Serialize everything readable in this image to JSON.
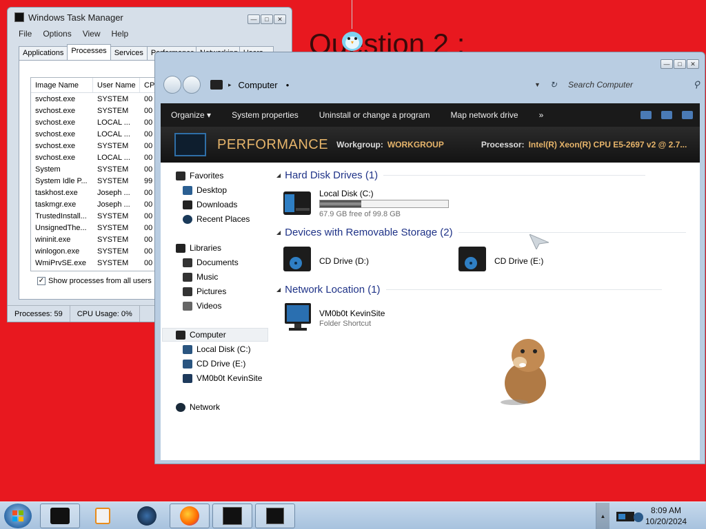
{
  "desktop": {
    "bg_text": "Question 2 :"
  },
  "task_manager": {
    "title": "Windows Task Manager",
    "menu": [
      "File",
      "Options",
      "View",
      "Help"
    ],
    "tabs": [
      "Applications",
      "Processes",
      "Services",
      "Performance",
      "Networking",
      "Users"
    ],
    "active_tab": "Processes",
    "columns": [
      "Image Name",
      "User Name",
      "CPU"
    ],
    "rows": [
      [
        "svchost.exe",
        "SYSTEM",
        "00"
      ],
      [
        "svchost.exe",
        "SYSTEM",
        "00"
      ],
      [
        "svchost.exe",
        "LOCAL ...",
        "00"
      ],
      [
        "svchost.exe",
        "LOCAL ...",
        "00"
      ],
      [
        "svchost.exe",
        "SYSTEM",
        "00"
      ],
      [
        "svchost.exe",
        "LOCAL ...",
        "00"
      ],
      [
        "System",
        "SYSTEM",
        "00"
      ],
      [
        "System Idle P...",
        "SYSTEM",
        "99"
      ],
      [
        "taskhost.exe",
        "Joseph ...",
        "00"
      ],
      [
        "taskmgr.exe",
        "Joseph ...",
        "00"
      ],
      [
        "TrustedInstall...",
        "SYSTEM",
        "00"
      ],
      [
        "UnsignedThe...",
        "SYSTEM",
        "00"
      ],
      [
        "wininit.exe",
        "SYSTEM",
        "00"
      ],
      [
        "winlogon.exe",
        "SYSTEM",
        "00"
      ],
      [
        "WmiPrvSE.exe",
        "SYSTEM",
        "00"
      ]
    ],
    "show_all_label": "Show processes from all users",
    "show_all_checked": true,
    "status_processes": "Processes: 59",
    "status_cpu": "CPU Usage: 0%"
  },
  "explorer": {
    "location": "Computer",
    "search_placeholder": "Search Computer",
    "commands": [
      "Organize ▾",
      "System properties",
      "Uninstall or change a program",
      "Map network drive",
      "»"
    ],
    "details": {
      "name": "PERFORMANCE",
      "workgroup_label": "Workgroup:",
      "workgroup": "WORKGROUP",
      "processor_label": "Processor:",
      "processor": "Intel(R) Xeon(R) CPU E5-2697 v2 @ 2.7..."
    },
    "nav": {
      "favorites": "Favorites",
      "desktop": "Desktop",
      "downloads": "Downloads",
      "recent": "Recent Places",
      "libraries": "Libraries",
      "documents": "Documents",
      "music": "Music",
      "pictures": "Pictures",
      "videos": "Videos",
      "computer": "Computer",
      "local_disk": "Local Disk (C:)",
      "cd_drive": "CD Drive (E:)",
      "vm_site": "VM0b0t KevinSite",
      "network": "Network"
    },
    "groups": {
      "hdd": "Hard Disk Drives (1)",
      "removable": "Devices with Removable Storage (2)",
      "network": "Network Location (1)"
    },
    "items": {
      "local_disk_name": "Local Disk (C:)",
      "local_disk_free": "67.9 GB free of 99.8 GB",
      "local_disk_used_fraction": 0.32,
      "cd_d": "CD Drive (D:)",
      "cd_e": "CD Drive (E:)",
      "net_name": "VM0b0t KevinSite",
      "net_sub": "Folder Shortcut"
    }
  },
  "taskbar": {
    "time": "8:09 AM",
    "date": "10/20/2024"
  }
}
